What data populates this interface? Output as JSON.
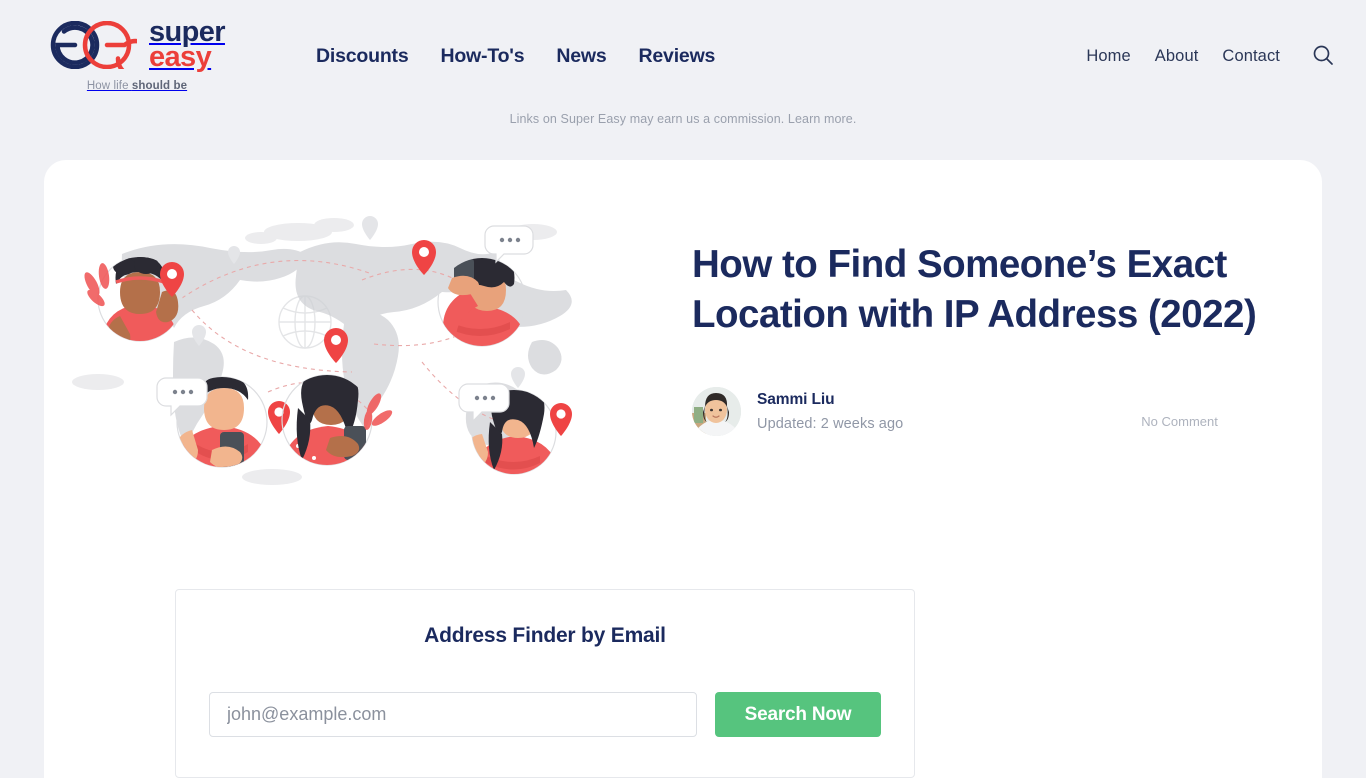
{
  "brand": {
    "logo_icon": "super-easy-double-e-logo",
    "word_top": "super",
    "word_bottom": "easy",
    "tagline_regular": "How life ",
    "tagline_bold": "should be",
    "navy": "#1b2a5e",
    "red": "#ec3f3a"
  },
  "nav": {
    "main": [
      {
        "label": "Discounts"
      },
      {
        "label": "How-To's"
      },
      {
        "label": "News"
      },
      {
        "label": "Reviews"
      }
    ],
    "right": [
      {
        "label": "Home"
      },
      {
        "label": "About"
      },
      {
        "label": "Contact"
      }
    ],
    "search_icon": "search-icon"
  },
  "disclaimer": {
    "text": "Links on Super Easy may earn us a commission. ",
    "link_label": "Learn more."
  },
  "article": {
    "title": "How to Find Someone’s Exact Location with IP Address (2022)",
    "hero_illustration": "world-map-location-sharing-illustration",
    "author_name": "Sammi Liu",
    "author_avatar": "author-avatar-photo",
    "updated": "Updated: 2 weeks ago",
    "comments": "No Comment"
  },
  "finder": {
    "title": "Address Finder by Email",
    "input_placeholder": "john@example.com",
    "input_value": "",
    "submit_label": "Search Now",
    "submit_color": "#56c47e"
  }
}
